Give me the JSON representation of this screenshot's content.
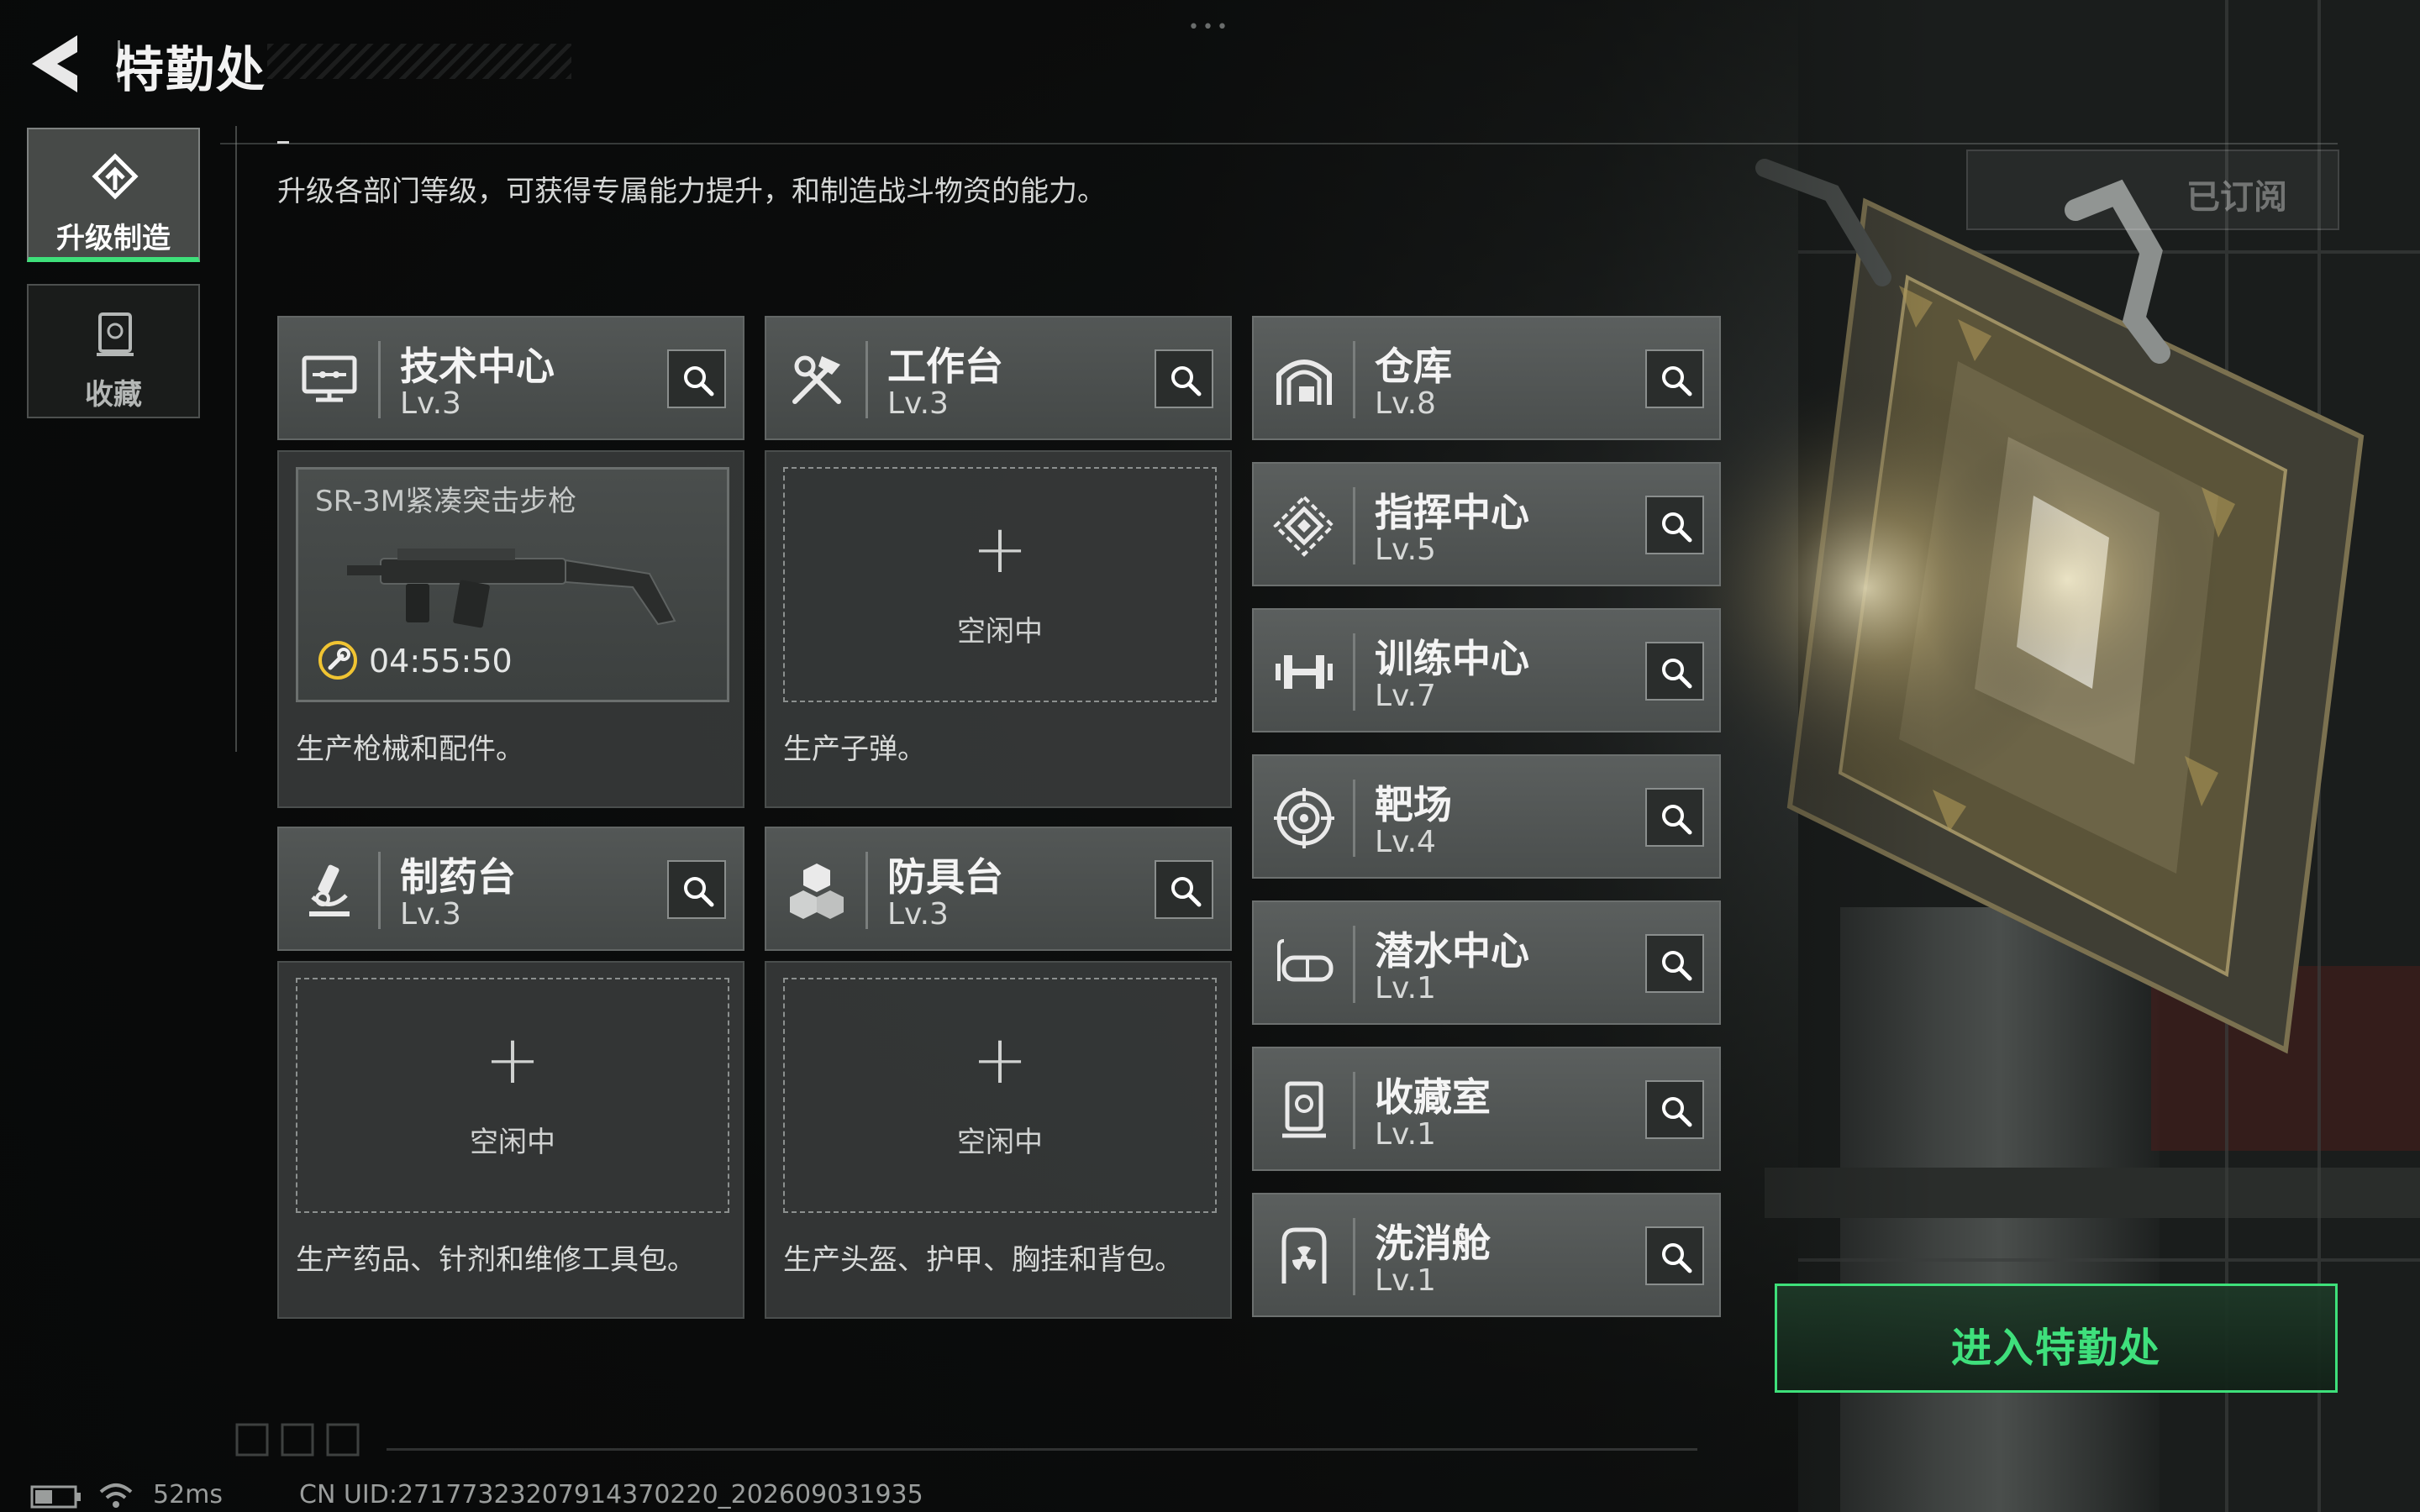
{
  "header": {
    "title": "特勤处",
    "dots": "•••"
  },
  "nav": [
    {
      "label": "升级制造",
      "icon": "upgrade-icon",
      "active": true
    },
    {
      "label": "收藏",
      "icon": "collection-icon",
      "active": false
    }
  ],
  "description": "升级各部门等级，可获得专属能力提升，和制造战斗物资的能力。",
  "subscribed_label": "已订阅",
  "cards": [
    {
      "name": "技术中心",
      "level": "Lv.3",
      "icon": "monitor-icon",
      "slot": {
        "state": "busy",
        "item": "SR-3M紧凑突击步枪",
        "timer": "04:55:50"
      },
      "desc": "生产枪械和配件。"
    },
    {
      "name": "工作台",
      "level": "Lv.3",
      "icon": "tools-icon",
      "slot": {
        "state": "idle",
        "plus": "+",
        "status": "空闲中"
      },
      "desc": "生产子弹。"
    },
    {
      "name": "制药台",
      "level": "Lv.3",
      "icon": "microscope-icon",
      "slot": {
        "state": "idle",
        "plus": "+",
        "status": "空闲中"
      },
      "desc": "生产药品、针剂和维修工具包。"
    },
    {
      "name": "防具台",
      "level": "Lv.3",
      "icon": "cubes-icon",
      "slot": {
        "state": "idle",
        "plus": "+",
        "status": "空闲中"
      },
      "desc": "生产头盔、护甲、胸挂和背包。"
    }
  ],
  "facilities": [
    {
      "name": "仓库",
      "level": "Lv.8",
      "icon": "warehouse-icon"
    },
    {
      "name": "指挥中心",
      "level": "Lv.5",
      "icon": "command-icon"
    },
    {
      "name": "训练中心",
      "level": "Lv.7",
      "icon": "dumbbell-icon"
    },
    {
      "name": "靶场",
      "level": "Lv.4",
      "icon": "target-icon"
    },
    {
      "name": "潜水中心",
      "level": "Lv.1",
      "icon": "diving-mask-icon"
    },
    {
      "name": "收藏室",
      "level": "Lv.1",
      "icon": "collection-room-icon"
    },
    {
      "name": "洗消舱",
      "level": "Lv.1",
      "icon": "radiation-icon"
    }
  ],
  "enter_button": "进入特勤处",
  "status": {
    "ping": "52ms",
    "uid": "CN UID:2717732320791437022​0_202609031935"
  },
  "colors": {
    "accent": "#3ee07a",
    "panel": "#444847",
    "text": "#e6e6e6"
  }
}
